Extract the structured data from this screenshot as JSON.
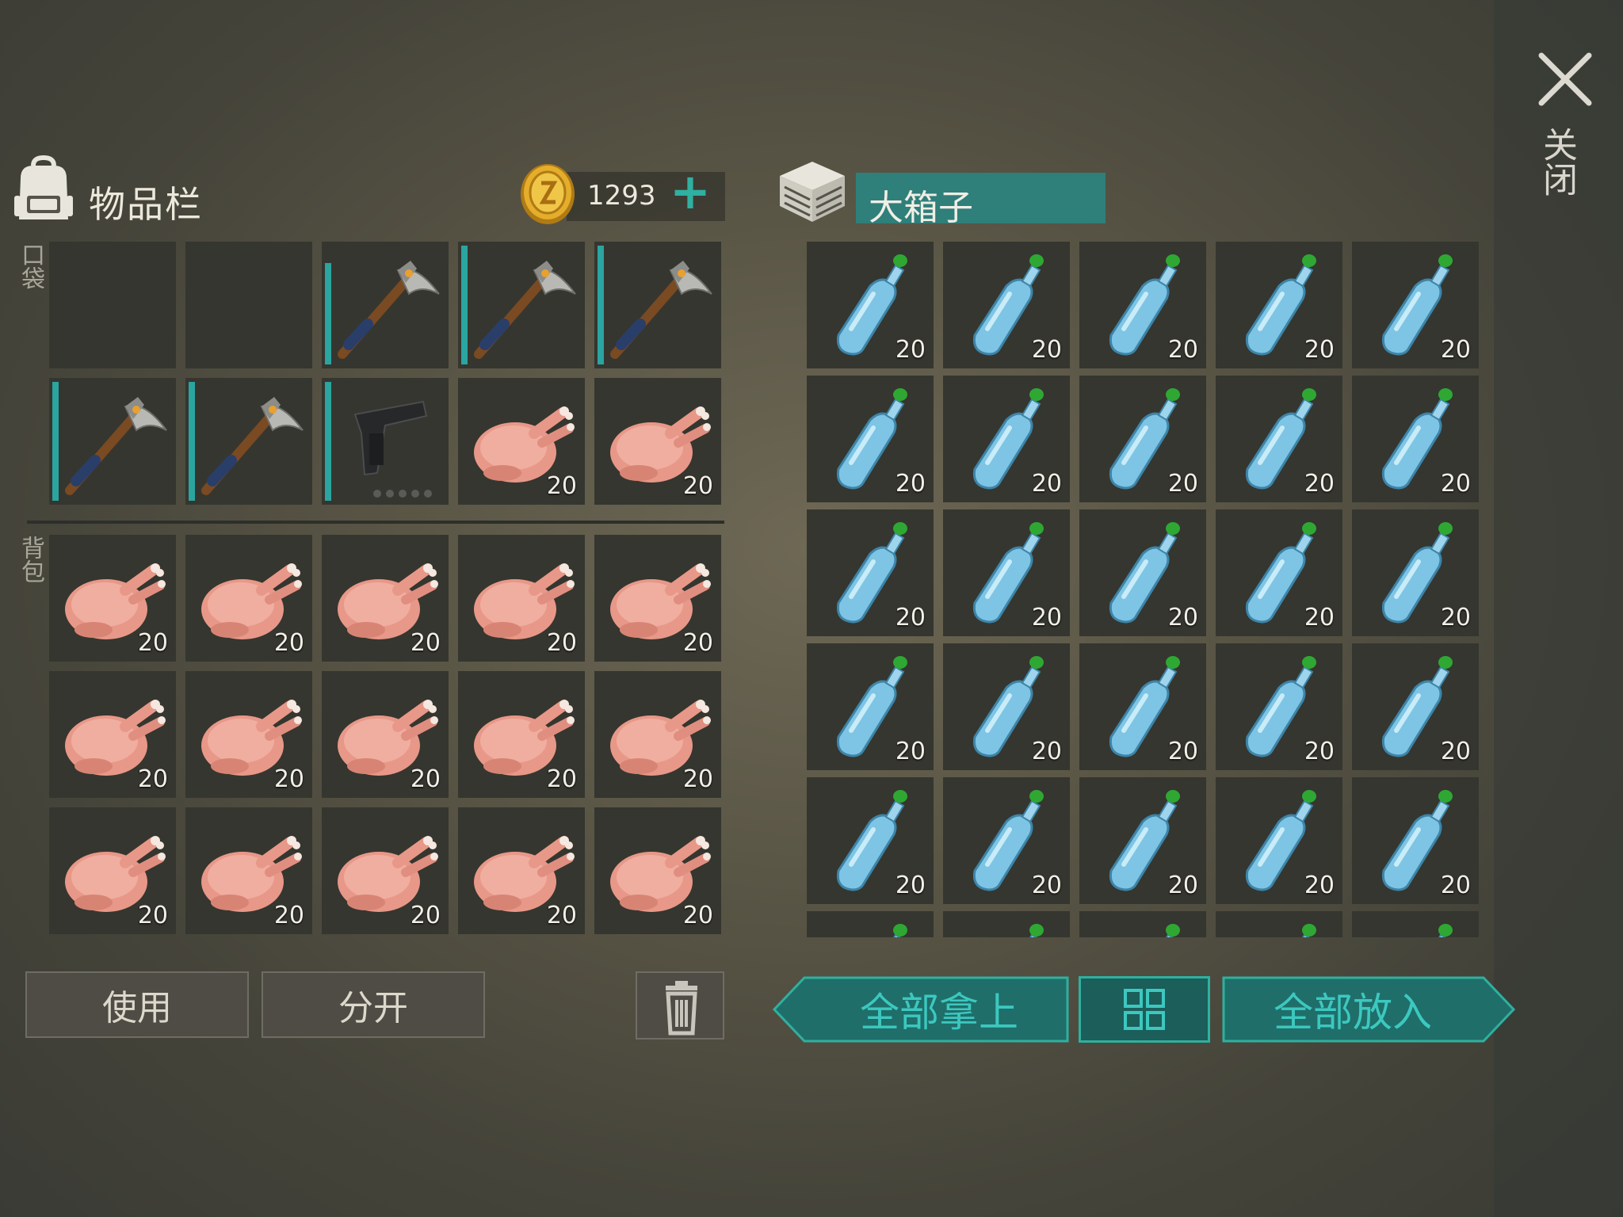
{
  "close": {
    "label": "关闭"
  },
  "inventory": {
    "title": "物品栏",
    "coins": "1293",
    "pocket_label": "口袋",
    "backpack_label": "背包",
    "pocket_slots": [
      {
        "item": "",
        "count": ""
      },
      {
        "item": "",
        "count": ""
      },
      {
        "item": "pickaxe",
        "count": "",
        "durability": 0.85
      },
      {
        "item": "pickaxe",
        "count": "",
        "durability": 1.0
      },
      {
        "item": "pickaxe",
        "count": "",
        "durability": 1.0
      },
      {
        "item": "pickaxe",
        "count": "",
        "durability": 1.0
      },
      {
        "item": "pickaxe",
        "count": "",
        "durability": 1.0
      },
      {
        "item": "pistol",
        "count": "",
        "durability": 1.0
      },
      {
        "item": "chicken",
        "count": "20"
      },
      {
        "item": "chicken",
        "count": "20"
      }
    ],
    "backpack_slots": [
      {
        "item": "chicken",
        "count": "20"
      },
      {
        "item": "chicken",
        "count": "20"
      },
      {
        "item": "chicken",
        "count": "20"
      },
      {
        "item": "chicken",
        "count": "20"
      },
      {
        "item": "chicken",
        "count": "20"
      },
      {
        "item": "chicken",
        "count": "20"
      },
      {
        "item": "chicken",
        "count": "20"
      },
      {
        "item": "chicken",
        "count": "20"
      },
      {
        "item": "chicken",
        "count": "20"
      },
      {
        "item": "chicken",
        "count": "20"
      },
      {
        "item": "chicken",
        "count": "20"
      },
      {
        "item": "chicken",
        "count": "20"
      },
      {
        "item": "chicken",
        "count": "20"
      },
      {
        "item": "chicken",
        "count": "20"
      },
      {
        "item": "chicken",
        "count": "20"
      }
    ],
    "buttons": {
      "use": "使用",
      "split": "分开"
    }
  },
  "chest": {
    "title": "大箱子",
    "slots": [
      {
        "item": "water-bottle",
        "count": "20"
      },
      {
        "item": "water-bottle",
        "count": "20"
      },
      {
        "item": "water-bottle",
        "count": "20"
      },
      {
        "item": "water-bottle",
        "count": "20"
      },
      {
        "item": "water-bottle",
        "count": "20"
      },
      {
        "item": "water-bottle",
        "count": "20"
      },
      {
        "item": "water-bottle",
        "count": "20"
      },
      {
        "item": "water-bottle",
        "count": "20"
      },
      {
        "item": "water-bottle",
        "count": "20"
      },
      {
        "item": "water-bottle",
        "count": "20"
      },
      {
        "item": "water-bottle",
        "count": "20"
      },
      {
        "item": "water-bottle",
        "count": "20"
      },
      {
        "item": "water-bottle",
        "count": "20"
      },
      {
        "item": "water-bottle",
        "count": "20"
      },
      {
        "item": "water-bottle",
        "count": "20"
      },
      {
        "item": "water-bottle",
        "count": "20"
      },
      {
        "item": "water-bottle",
        "count": "20"
      },
      {
        "item": "water-bottle",
        "count": "20"
      },
      {
        "item": "water-bottle",
        "count": "20"
      },
      {
        "item": "water-bottle",
        "count": "20"
      },
      {
        "item": "water-bottle",
        "count": "20"
      },
      {
        "item": "water-bottle",
        "count": "20"
      },
      {
        "item": "water-bottle",
        "count": "20"
      },
      {
        "item": "water-bottle",
        "count": "20"
      },
      {
        "item": "water-bottle",
        "count": "20"
      },
      {
        "item": "water-bottle",
        "count": ""
      },
      {
        "item": "water-bottle",
        "count": ""
      },
      {
        "item": "water-bottle",
        "count": ""
      },
      {
        "item": "water-bottle",
        "count": ""
      },
      {
        "item": "water-bottle",
        "count": ""
      }
    ],
    "buttons": {
      "take_all": "全部拿上",
      "put_all": "全部放入"
    }
  },
  "colors": {
    "accent": "#2fb0a0",
    "teal_button": "#1f6e6a",
    "slot_bg": "#35362f"
  }
}
